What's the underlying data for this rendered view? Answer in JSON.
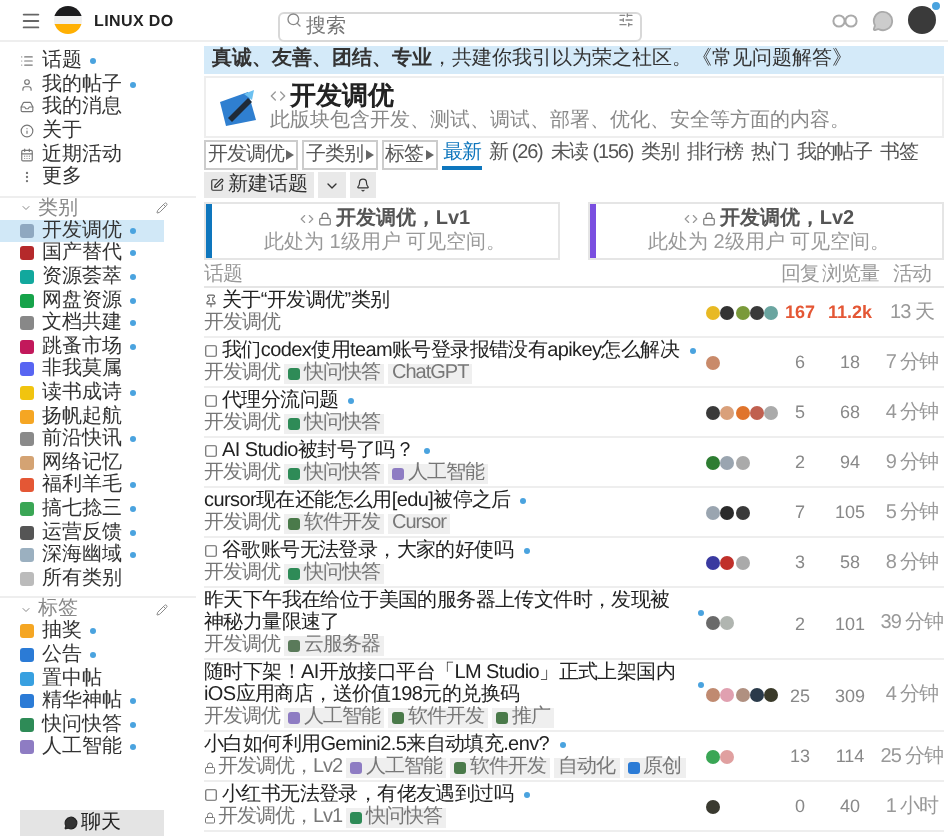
{
  "header": {
    "site_name": "LINUX DO",
    "search": {
      "placeholder": "搜索"
    }
  },
  "sidebar": {
    "nav": [
      {
        "label": "话题",
        "new": true
      },
      {
        "label": "我的帖子",
        "new": true
      },
      {
        "label": "我的消息",
        "new": false
      },
      {
        "label": "关于",
        "new": false
      },
      {
        "label": "近期活动",
        "new": false
      },
      {
        "label": "更多",
        "new": false
      }
    ],
    "categories_heading": "类别",
    "categories": [
      {
        "label": "开发调优",
        "new": true,
        "selected": true,
        "color": "#8fa8c0"
      },
      {
        "label": "国产替代",
        "new": true,
        "selected": false,
        "color": "#b5292b"
      },
      {
        "label": "资源荟萃",
        "new": true,
        "selected": false,
        "color": "#12a89d"
      },
      {
        "label": "网盘资源",
        "new": true,
        "selected": false,
        "color": "#16a34a"
      },
      {
        "label": "文档共建",
        "new": true,
        "selected": false,
        "color": "#888888"
      },
      {
        "label": "跳蚤市场",
        "new": true,
        "selected": false,
        "color": "#c2185b"
      },
      {
        "label": "非我莫属",
        "new": false,
        "selected": false,
        "color": "#5865f2"
      },
      {
        "label": "读书成诗",
        "new": true,
        "selected": false,
        "color": "#f1c40f"
      },
      {
        "label": "扬帆起航",
        "new": false,
        "selected": false,
        "color": "#f5a623"
      },
      {
        "label": "前沿快讯",
        "new": true,
        "selected": false,
        "color": "#8a8a8a"
      },
      {
        "label": "网络记忆",
        "new": false,
        "selected": false,
        "color": "#d4a373"
      },
      {
        "label": "福利羊毛",
        "new": true,
        "selected": false,
        "color": "#e45735"
      },
      {
        "label": "搞七捻三",
        "new": true,
        "selected": false,
        "color": "#3aa655"
      },
      {
        "label": "运营反馈",
        "new": true,
        "selected": false,
        "color": "#555555"
      },
      {
        "label": "深海幽域",
        "new": true,
        "selected": false,
        "color": "#9bb0c0"
      },
      {
        "label": "所有类别",
        "new": false,
        "selected": false,
        "color": "#bbbbbb"
      }
    ],
    "tags_heading": "标签",
    "tags": [
      {
        "label": "抽奖",
        "new": true,
        "color": "#f5a623"
      },
      {
        "label": "公告",
        "new": true,
        "color": "#2b7bd6"
      },
      {
        "label": "置中帖",
        "new": false,
        "color": "#38a0e0"
      },
      {
        "label": "精华神帖",
        "new": true,
        "color": "#2b7bd6"
      },
      {
        "label": "快问快答",
        "new": true,
        "color": "#2e8b57"
      },
      {
        "label": "人工智能",
        "new": true,
        "color": "#8e7cc3"
      }
    ],
    "chat_button": "聊天"
  },
  "banner": "**真诚、友善、团结、专业**，共建你我引以为荣之社区。《常见问题解答》",
  "category": {
    "title": "开发调优",
    "description": "此版块包含开发、测试、调试、部署、优化、安全等方面的内容。"
  },
  "filters": [
    "开发调优",
    "子类别",
    "标签"
  ],
  "tabs": [
    {
      "label": "最新",
      "selected": true
    },
    {
      "label": "新 (26)",
      "selected": false
    },
    {
      "label": "未读 (156)",
      "selected": false
    },
    {
      "label": "类别",
      "selected": false
    },
    {
      "label": "排行榜",
      "selected": false
    },
    {
      "label": "热门",
      "selected": false
    },
    {
      "label": "我的帖子",
      "selected": false
    },
    {
      "label": "书签",
      "selected": false
    }
  ],
  "new_topic_button": "新建话题",
  "level_cards": [
    {
      "title": "开发调优，Lv1",
      "note": "此处为 1级用户 可见空间。",
      "color": "#0e76bd"
    },
    {
      "title": "开发调优，Lv2",
      "note": "此处为 2级用户 可见空间。",
      "color": "#7a4fe0"
    }
  ],
  "columns": [
    "话题",
    "回复",
    "浏览量",
    "活动"
  ],
  "topics": [
    {
      "kind": "pinned",
      "title": "关于“开发调优”类别",
      "unread": false,
      "category": "开发调优",
      "locked": false,
      "avatars": [
        {
          "color": "#e8b923"
        },
        {
          "color": "#333333"
        },
        {
          "color": "#7a9a3a"
        },
        {
          "color": "#3a3a3a"
        },
        {
          "color": "#6aa5a0"
        }
      ],
      "replies": "167",
      "views": "11.2k",
      "hot": true,
      "activity": "13 天"
    },
    {
      "kind": "question",
      "title": "我们codex使用team账号登录报错没有apikey怎么解决",
      "unread": true,
      "category": "开发调优",
      "locked": false,
      "tags": [
        {
          "label": "快问快答",
          "color": "#2e8b57"
        },
        {
          "label": "ChatGPT"
        }
      ],
      "avatars": [
        {
          "color": "#c98a6a"
        }
      ],
      "replies": "6",
      "views": "18",
      "hot": false,
      "activity": "7 分钟"
    },
    {
      "kind": "question",
      "title": "代理分流问题",
      "unread": true,
      "category": "开发调优",
      "locked": false,
      "tags": [
        {
          "label": "快问快答",
          "color": "#2e8b57"
        }
      ],
      "avatars": [
        {
          "color": "#3a3a3a"
        },
        {
          "color": "#d9a07a"
        },
        {
          "color": "#e0742c"
        },
        {
          "color": "#c06050"
        },
        {
          "color": "#aaaaaa"
        }
      ],
      "replies": "5",
      "views": "68",
      "hot": false,
      "activity": "4 分钟"
    },
    {
      "kind": "question",
      "title": "AI Studio被封号了吗？",
      "unread": true,
      "category": "开发调优",
      "locked": false,
      "tags": [
        {
          "label": "快问快答",
          "color": "#2e8b57"
        },
        {
          "label": "人工智能",
          "color": "#8e7cc3"
        }
      ],
      "avatars": [
        {
          "color": "#2e7d32"
        },
        {
          "color": "#9aa5b0"
        },
        {
          "color": "#aaaaaa"
        }
      ],
      "replies": "2",
      "views": "94",
      "hot": false,
      "activity": "9 分钟"
    },
    {
      "kind": "plain",
      "title": "cursor现在还能怎么用[edu]被停之后",
      "unread": true,
      "category": "开发调优",
      "locked": false,
      "tags": [
        {
          "label": "软件开发",
          "color": "#4a7a4a"
        },
        {
          "label": "Cursor"
        }
      ],
      "avatars": [
        {
          "color": "#9aa5b0"
        },
        {
          "color": "#2a2a2a"
        },
        {
          "color": "#3a3a3a"
        }
      ],
      "replies": "7",
      "views": "105",
      "hot": false,
      "activity": "5 分钟"
    },
    {
      "kind": "question",
      "title": "谷歌账号无法登录，大家的好使吗",
      "unread": true,
      "category": "开发调优",
      "locked": false,
      "tags": [
        {
          "label": "快问快答",
          "color": "#2e8b57"
        }
      ],
      "avatars": [
        {
          "color": "#3a3aa0"
        },
        {
          "color": "#c0302a"
        },
        {
          "color": "#aaaaaa"
        }
      ],
      "replies": "3",
      "views": "58",
      "hot": false,
      "activity": "8 分钟"
    },
    {
      "kind": "plain",
      "title": "昨天下午我在给位于美国的服务器上传文件时，发现被神秘力量限速了",
      "unread": true,
      "category": "开发调优",
      "locked": false,
      "tags": [
        {
          "label": "云服务器",
          "color": "#5a7a5a"
        }
      ],
      "avatars": [
        {
          "color": "#6a6a6a"
        },
        {
          "color": "#b0b5b0"
        }
      ],
      "replies": "2",
      "views": "101",
      "hot": false,
      "activity": "39 分钟"
    },
    {
      "kind": "plain",
      "title": "随时下架！AI开放接口平台「LM Studio」正式上架国内iOS应用商店，送价值198元的兑换码",
      "unread": true,
      "category": "开发调优",
      "locked": false,
      "tags": [
        {
          "label": "人工智能",
          "color": "#8e7cc3"
        },
        {
          "label": "软件开发",
          "color": "#4a7a4a"
        },
        {
          "label": "推广",
          "color": "#4a7a4a"
        }
      ],
      "avatars": [
        {
          "color": "#c08a70"
        },
        {
          "color": "#e0a0b0"
        },
        {
          "color": "#b09080"
        },
        {
          "color": "#2a3a4a"
        },
        {
          "color": "#3a3a2a"
        }
      ],
      "replies": "25",
      "views": "309",
      "hot": false,
      "activity": "4 分钟"
    },
    {
      "kind": "plain",
      "title": "小白如何利用Gemini2.5来自动填充.env?",
      "unread": true,
      "category": "开发调优，Lv2",
      "locked": true,
      "tags": [
        {
          "label": "人工智能",
          "color": "#8e7cc3"
        },
        {
          "label": "软件开发",
          "color": "#4a7a4a"
        },
        {
          "label": "自动化"
        },
        {
          "label": "原创",
          "color": "#2b7bd6"
        }
      ],
      "avatars": [
        {
          "color": "#3aa655"
        },
        {
          "color": "#e0a0a0"
        }
      ],
      "replies": "13",
      "views": "114",
      "hot": false,
      "activity": "25 分钟"
    },
    {
      "kind": "question",
      "title": "小红书无法登录，有佬友遇到过吗",
      "unread": true,
      "category": "开发调优，Lv1",
      "locked": true,
      "tags": [
        {
          "label": "快问快答",
          "color": "#2e8b57"
        }
      ],
      "avatars": [
        {
          "color": "#3a3a30"
        }
      ],
      "replies": "0",
      "views": "40",
      "hot": false,
      "activity": "1 小时"
    }
  ]
}
